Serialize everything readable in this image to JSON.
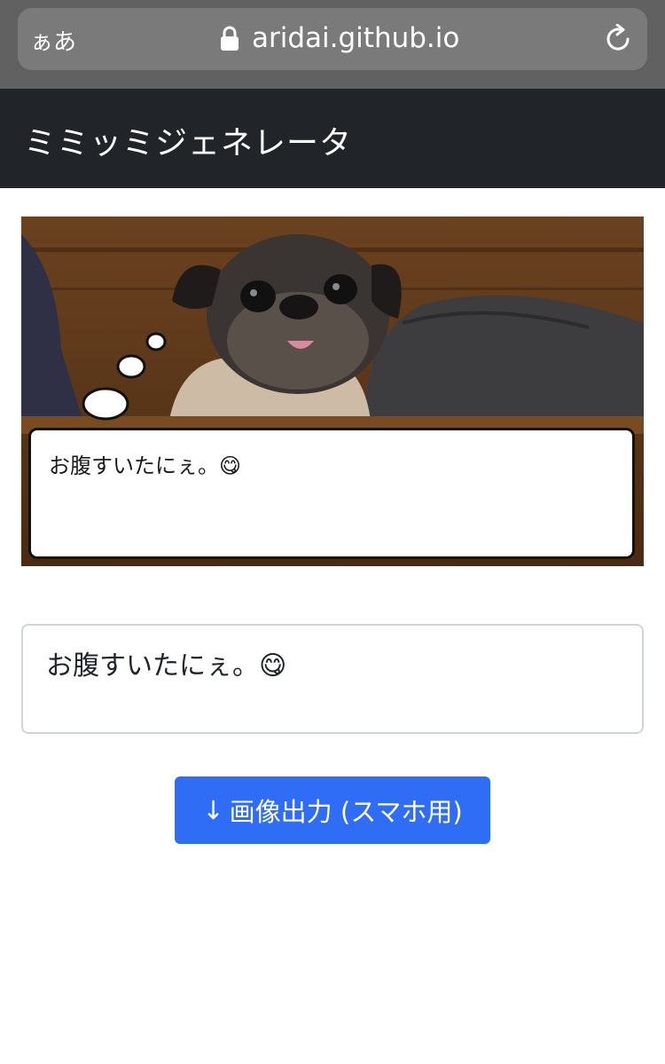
{
  "browser": {
    "text_size_button": "ぁあ",
    "url": "aridai.github.io"
  },
  "navbar": {
    "title": "ミミッミジェネレータ"
  },
  "preview": {
    "speech_text": "お腹すいたにぇ。😋"
  },
  "editor": {
    "message_value": "お腹すいたにぇ。😋"
  },
  "actions": {
    "export_arrow": "↓",
    "export_label": "画像出力 (スマホ用)"
  },
  "colors": {
    "browser_bar": "#616161",
    "navbar": "#212529",
    "button": "#2f6df6"
  }
}
